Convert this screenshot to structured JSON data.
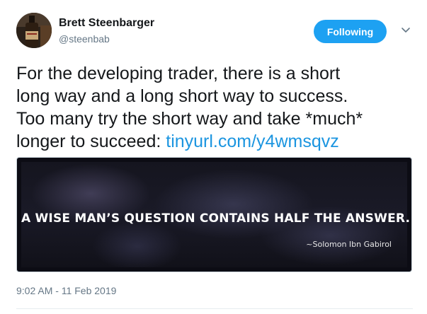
{
  "author": {
    "name": "Brett Steenbarger",
    "handle": "@steenbab",
    "avatar_icon": "profile-photo-bottle"
  },
  "follow_button": {
    "label": "Following",
    "color": "#1da1f2"
  },
  "menu_icon": "chevron-down-icon",
  "tweet": {
    "lines": [
      "For the developing trader, there is a short",
      "long way and a long short way to success.",
      "Too many try the short way and take *much*"
    ],
    "last_line_prefix": "longer to succeed: ",
    "link_text": "tinyurl.com/y4wmsqvz",
    "link_color": "#1b95e0"
  },
  "media": {
    "quote": "A WISE MAN’S QUESTION CONTAINS HALF THE ANSWER.",
    "attribution": "~Solomon Ibn Gabirol"
  },
  "timestamp": "9:02 AM - 11 Feb 2019"
}
